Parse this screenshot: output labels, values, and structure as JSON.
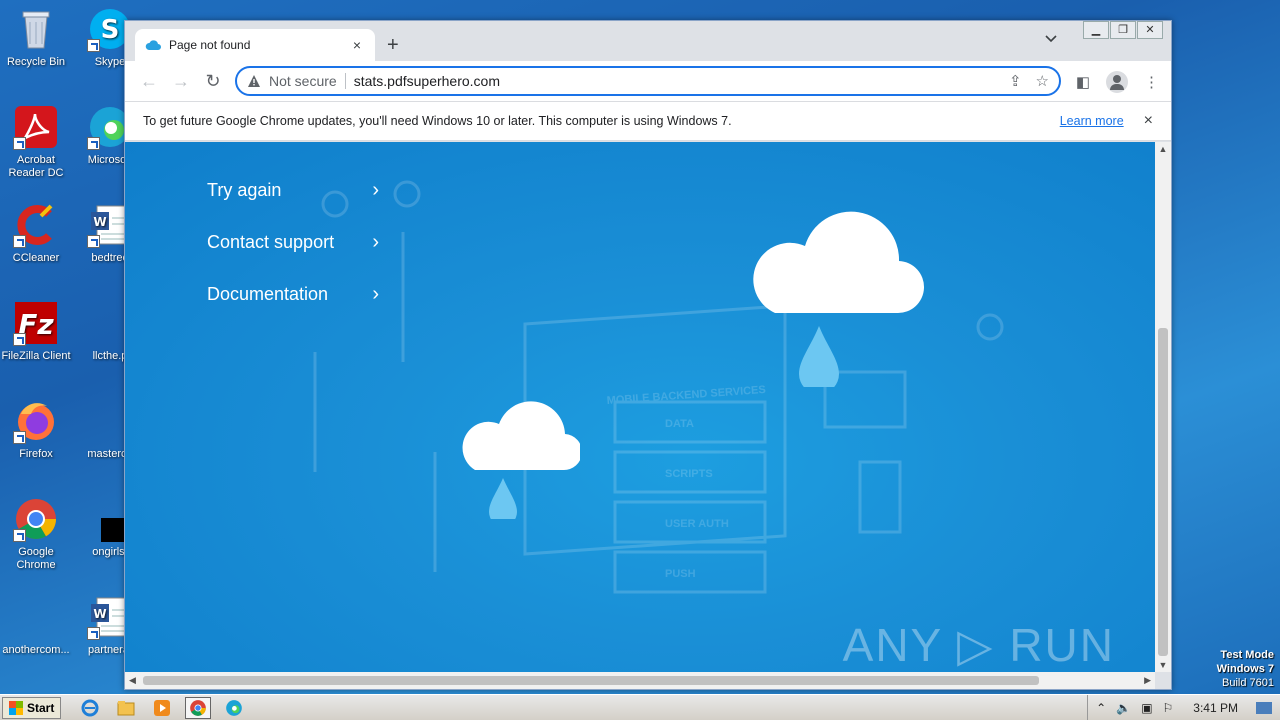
{
  "desktop": {
    "icons": [
      {
        "label": "Recycle Bin",
        "icon": "recycle-bin-icon"
      },
      {
        "label": "Skype",
        "icon": "skype-icon"
      },
      {
        "label": "Acrobat Reader DC",
        "icon": "acrobat-icon"
      },
      {
        "label": "Microsoft",
        "icon": "edge-icon"
      },
      {
        "label": "CCleaner",
        "icon": "ccleaner-icon"
      },
      {
        "label": "bedtree",
        "icon": "word-doc-icon"
      },
      {
        "label": "FileZilla Client",
        "icon": "filezilla-icon"
      },
      {
        "label": "llcthe.p",
        "icon": "blank-file-icon"
      },
      {
        "label": "Firefox",
        "icon": "firefox-icon"
      },
      {
        "label": "masterco",
        "icon": "blank-file-icon"
      },
      {
        "label": "Google Chrome",
        "icon": "chrome-icon"
      },
      {
        "label": "ongirls.",
        "icon": "black-file-icon"
      },
      {
        "label": "anothercom...",
        "icon": "blank-file-icon"
      },
      {
        "label": "partnerat",
        "icon": "word-doc-icon"
      }
    ]
  },
  "browser": {
    "tab_title": "Page not found",
    "new_tab": "+",
    "tab_close": "×",
    "address": {
      "security_label": "Not secure",
      "url": "stats.pdfsuperhero.com"
    },
    "infobar": {
      "message": "To get future Google Chrome updates, you'll need Windows 10 or later. This computer is using Windows 7.",
      "link": "Learn more",
      "close": "×"
    }
  },
  "page": {
    "menu": [
      {
        "label": "Try again"
      },
      {
        "label": "Contact support"
      },
      {
        "label": "Documentation"
      }
    ],
    "chevron": "›",
    "bg_texts": {
      "heading": "MOBILE BACKEND SERVICES",
      "rows": [
        "DATA",
        "SCRIPTS",
        "USER AUTH",
        "PUSH"
      ]
    },
    "watermark": "ANY ▷ RUN"
  },
  "taskbar": {
    "start_label": "Start",
    "clock": "3:41 PM"
  },
  "system": {
    "test_mode": "Test Mode",
    "os": "Windows 7",
    "build": "Build 7601"
  },
  "colors": {
    "page_bg": "#1a8fd6",
    "accent": "#1a73e8"
  }
}
